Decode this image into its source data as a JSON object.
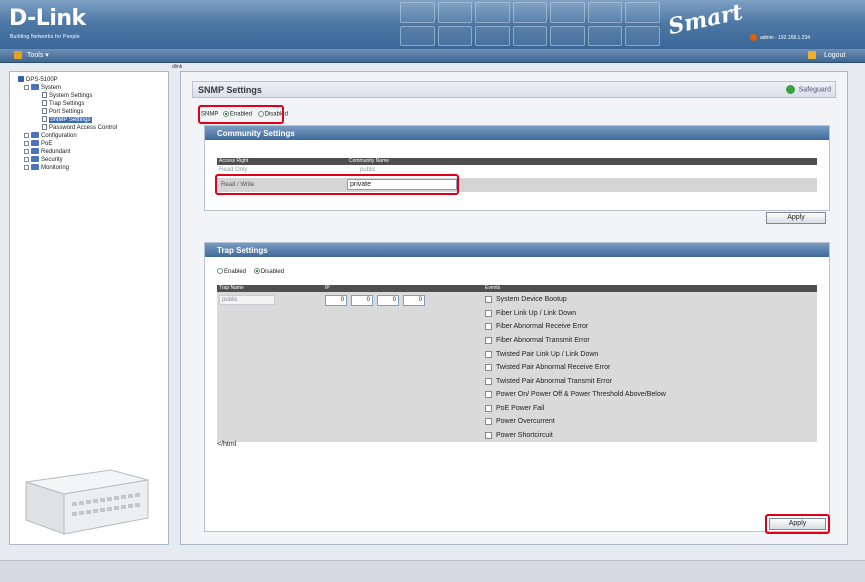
{
  "header": {
    "logo": "D-Link",
    "tagline": "Building Networks for People",
    "product_badge": "Smart",
    "user_info": "admin - 192.168.1.234"
  },
  "toolbar": {
    "tools_label": "Tools",
    "logout_label": "Logout"
  },
  "breadcrumb": "dlink",
  "tree": {
    "root": "DPS-5100P",
    "system": "System",
    "system_items": [
      "System Settings",
      "Trap Settings",
      "Port Settings",
      "SNMP Settings",
      "Password Access Control"
    ],
    "selected_index": 3,
    "folders": [
      "Configuration",
      "PoE",
      "Redundant",
      "Security",
      "Monitoring"
    ]
  },
  "page": {
    "title": "SNMP Settings",
    "safeguard": "Safeguard"
  },
  "snmp": {
    "label": "SNMP",
    "enabled_label": "Enabled",
    "disabled_label": "Disabled",
    "state": "enabled"
  },
  "community": {
    "heading": "Community Settings",
    "col_access": "Access Right",
    "col_name": "Community Name",
    "rows": [
      {
        "access": "Read Only",
        "name": "public"
      },
      {
        "access": "Read / Write",
        "name": "private"
      }
    ],
    "apply_label": "Apply"
  },
  "trap": {
    "heading": "Trap Settings",
    "enabled_label": "Enabled",
    "disabled_label": "Disabled",
    "state": "disabled",
    "col_name": "Trap Name",
    "col_ip": "IP",
    "col_events": "Events",
    "trap_name_value": "public",
    "ip": [
      "0",
      "0",
      "0",
      "0"
    ],
    "events": [
      "System Device Bootup",
      "Fiber Link Up / Link Down",
      "Fiber Abnormal Receive Error",
      "Fiber Abnormal Transmit Error",
      "Twisted Pair Link Up / Link Down",
      "Twisted Pair Abnormal Receive Error",
      "Twisted Pair Abnormal Transmit Error",
      "Power On/ Power Off & Power Threshold Above/Below",
      "PoE Power Fail",
      "Power Overcurrent",
      "Power Shortcircuit"
    ],
    "stray_text": "</html",
    "apply_label": "Apply"
  },
  "colors": {
    "accent_red": "#e0001a",
    "header_blue": "#4e79a6",
    "selected_blue": "#3b6db5"
  }
}
